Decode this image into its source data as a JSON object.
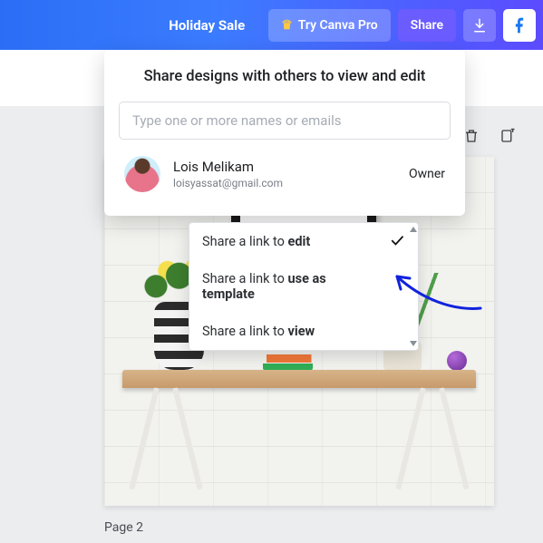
{
  "topbar": {
    "sale_label": "Holiday Sale",
    "pro_label": "Try Canva Pro",
    "share_label": "Share"
  },
  "share_popover": {
    "title": "Share designs with others to view and edit",
    "input_placeholder": "Type one or more names or emails",
    "owner": {
      "name": "Lois Melikam",
      "email": "loisyassat@gmail.com",
      "role": "Owner"
    },
    "link_options": {
      "prefix": "Share a link to ",
      "items": [
        {
          "bold": "edit",
          "selected": true
        },
        {
          "bold": "use as template",
          "selected": false
        },
        {
          "bold": "view",
          "selected": false
        }
      ]
    }
  },
  "canvas": {
    "page_label": "Page 2"
  }
}
